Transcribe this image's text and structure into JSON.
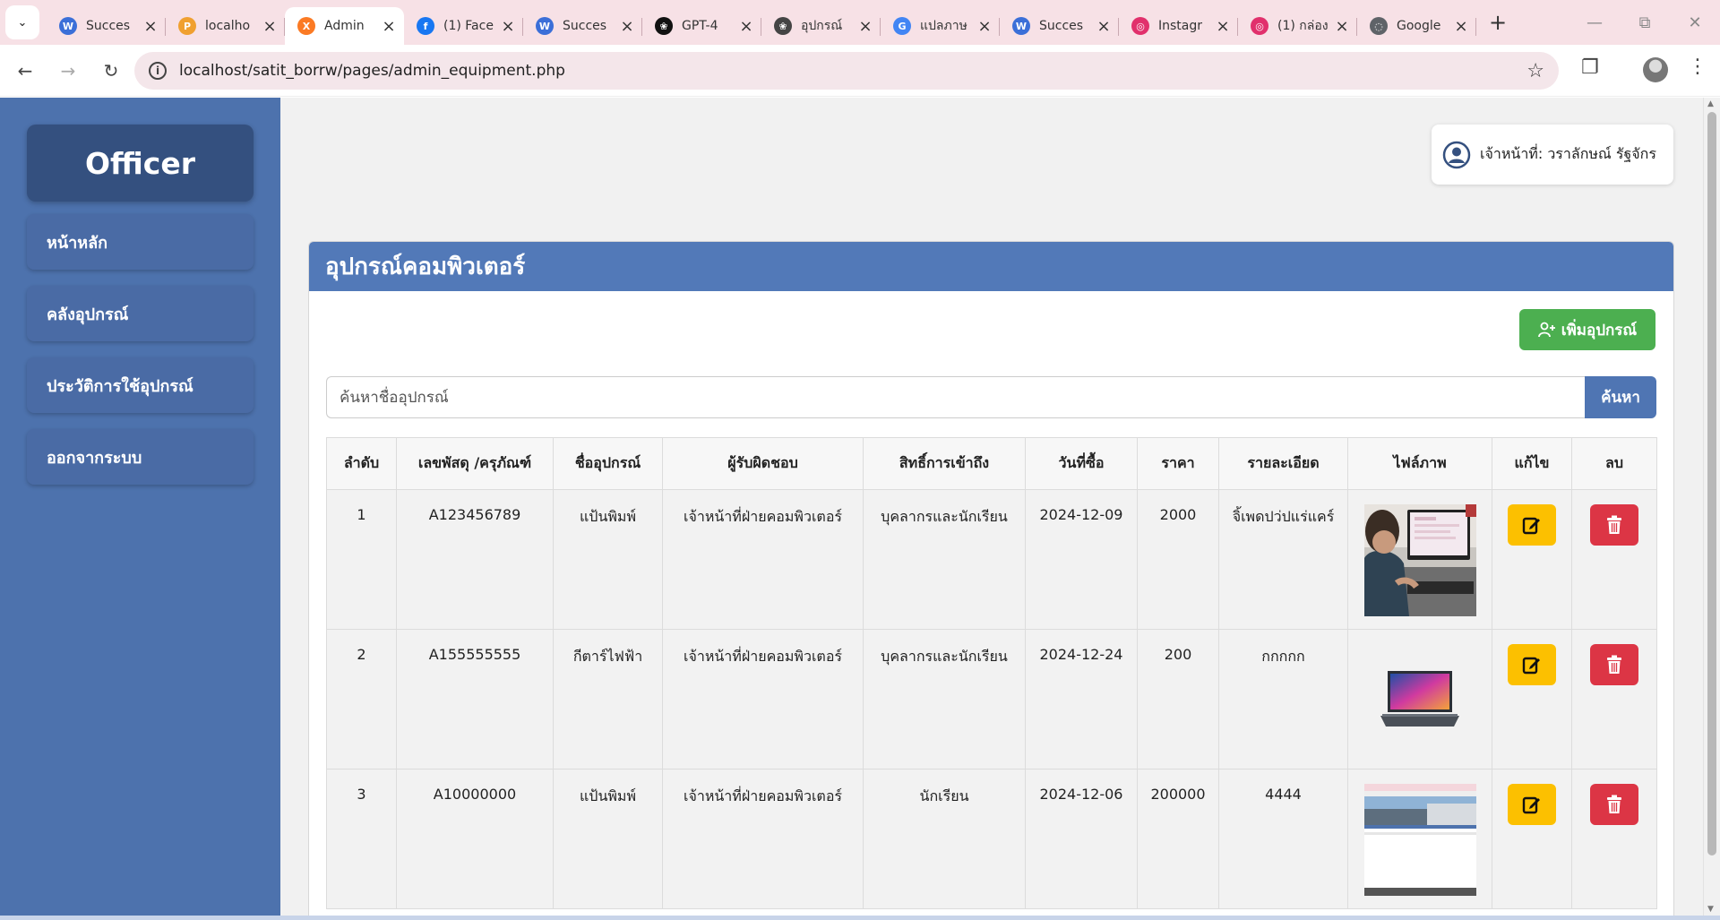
{
  "browser": {
    "tabs": [
      {
        "title": "Succes",
        "favicon": "wordpress-icon",
        "color": "#3b6fd8",
        "active": false
      },
      {
        "title": "localho",
        "favicon": "phpmyadmin-icon",
        "color": "#f0a030",
        "active": false
      },
      {
        "title": "Admin",
        "favicon": "xampp-icon",
        "color": "#fb7a24",
        "active": true
      },
      {
        "title": "(1) Face",
        "favicon": "facebook-icon",
        "color": "#1877f2",
        "active": false
      },
      {
        "title": "Succes",
        "favicon": "wordpress-icon",
        "color": "#3b6fd8",
        "active": false
      },
      {
        "title": "GPT-4",
        "favicon": "openai-icon",
        "color": "#111111",
        "active": false
      },
      {
        "title": "อุปกรณ์",
        "favicon": "openai-icon",
        "color": "#444444",
        "active": false
      },
      {
        "title": "แปลภาษ",
        "favicon": "google-icon",
        "color": "#4285f4",
        "active": false
      },
      {
        "title": "Succes",
        "favicon": "wordpress-icon",
        "color": "#3b6fd8",
        "active": false
      },
      {
        "title": "Instagr",
        "favicon": "instagram-icon",
        "color": "#e1306c",
        "active": false
      },
      {
        "title": "(1) กล่อง",
        "favicon": "instagram-icon",
        "color": "#e1306c",
        "active": false
      },
      {
        "title": "Google",
        "favicon": "globe-icon",
        "color": "#5f6368",
        "active": false
      }
    ],
    "url": "localhost/satit_borrw/pages/admin_equipment.php"
  },
  "sidebar": {
    "brand": "Officer",
    "items": [
      {
        "label": "หน้าหลัก"
      },
      {
        "label": "คลังอุปกรณ์"
      },
      {
        "label": "ประวัติการใช้อุปกรณ์"
      },
      {
        "label": "ออกจากระบบ"
      }
    ]
  },
  "user": {
    "label": "เจ้าหน้าที่: วราลักษณ์ รัฐจักร"
  },
  "main": {
    "title": "อุปกรณ์คอมพิวเตอร์",
    "add_label": "เพิ่มอุปกรณ์",
    "search_placeholder": "ค้นหาชื่ออุปกรณ์",
    "search_button": "ค้นหา",
    "columns": [
      "ลำดับ",
      "เลขพัสดุ /ครุภัณฑ์",
      "ชื่ออุปกรณ์",
      "ผู้รับผิดชอบ",
      "สิทธิ์การเข้าถึง",
      "วันที่ซื้อ",
      "ราคา",
      "รายละเอียด",
      "ไฟล์ภาพ",
      "แก้ไข",
      "ลบ"
    ],
    "rows": [
      {
        "no": "1",
        "code": "A123456789",
        "name": "แป้นพิมพ์",
        "owner": "เจ้าหน้าที่ฝ่ายคอมพิวเตอร์",
        "access": "บุคลากรและนักเรียน",
        "date": "2024-12-09",
        "price": "2000",
        "detail": "จิ้เพดปว่ปแร่แคร์",
        "image": "photo-person-at-computer"
      },
      {
        "no": "2",
        "code": "A155555555",
        "name": "กีตาร์ไฟฟ้า",
        "owner": "เจ้าหน้าที่ฝ่ายคอมพิวเตอร์",
        "access": "บุคลากรและนักเรียน",
        "date": "2024-12-24",
        "price": "200",
        "detail": "กกกกก",
        "image": "photo-laptop"
      },
      {
        "no": "3",
        "code": "A10000000",
        "name": "แป้นพิมพ์",
        "owner": "เจ้าหน้าที่ฝ่ายคอมพิวเตอร์",
        "access": "นักเรียน",
        "date": "2024-12-06",
        "price": "200000",
        "detail": "4444",
        "image": "screenshot-webpage"
      }
    ]
  },
  "colors": {
    "sidebar": "#4d72ad",
    "brand_box": "#34507f",
    "card_header": "#5279b8",
    "add_button": "#4caf50",
    "search_button": "#4f75b3",
    "edit_button": "#fcc000",
    "delete_button": "#dc3545"
  }
}
